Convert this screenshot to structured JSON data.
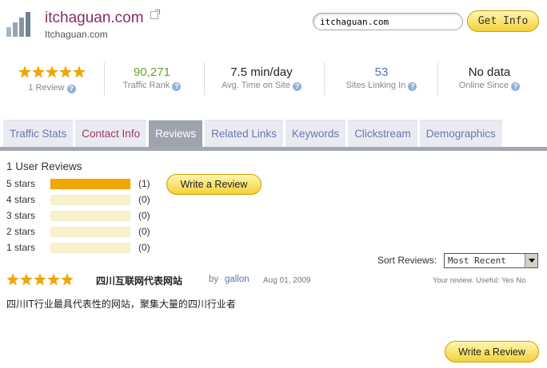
{
  "header": {
    "site_title": "itchaguan.com",
    "site_subtitle": "Itchaguan.com",
    "search_value": "itchaguan.com",
    "get_info_label": "Get Info"
  },
  "stats": {
    "reviews": {
      "stars": 5,
      "label": "1 Review"
    },
    "traffic_rank": {
      "value": "90,271",
      "label": "Traffic Rank"
    },
    "avg_time": {
      "value": "7.5 min/day",
      "label": "Avg. Time on Site"
    },
    "sites_linking": {
      "value": "53",
      "label": "Sites Linking In"
    },
    "online_since": {
      "value": "No data",
      "label": "Online Since"
    },
    "help_glyph": "?"
  },
  "tabs": [
    {
      "label": "Traffic Stats"
    },
    {
      "label": "Contact Info"
    },
    {
      "label": "Reviews"
    },
    {
      "label": "Related Links"
    },
    {
      "label": "Keywords"
    },
    {
      "label": "Clickstream"
    },
    {
      "label": "Demographics"
    }
  ],
  "active_tab": "Reviews",
  "reviews_summary": {
    "title": "1 User Reviews",
    "rows": [
      {
        "label": "5 stars",
        "count": "(1)",
        "fraction": 1
      },
      {
        "label": "4 stars",
        "count": "(0)",
        "fraction": 0
      },
      {
        "label": "3 stars",
        "count": "(0)",
        "fraction": 0
      },
      {
        "label": "2 stars",
        "count": "(0)",
        "fraction": 0
      },
      {
        "label": "1 stars",
        "count": "(0)",
        "fraction": 0
      }
    ],
    "write_review_label": "Write a Review"
  },
  "sort": {
    "label": "Sort Reviews:",
    "selected": "Most Recent"
  },
  "review": {
    "stars": 5,
    "title": "四川互联网代表网站",
    "by": "by",
    "author": "gallon",
    "date": "Aug 01, 2009",
    "meta": "Your review. Useful: Yes No",
    "body": "四川IT行业最具代表性的网站，聚集大量的四川行业者"
  },
  "colors": {
    "brand_title": "#8a2a6a",
    "star": "#f0a500",
    "link": "#6a78b0",
    "active_tab_bg": "#9fa3ad",
    "traffic_rank": "#6aa22a"
  }
}
